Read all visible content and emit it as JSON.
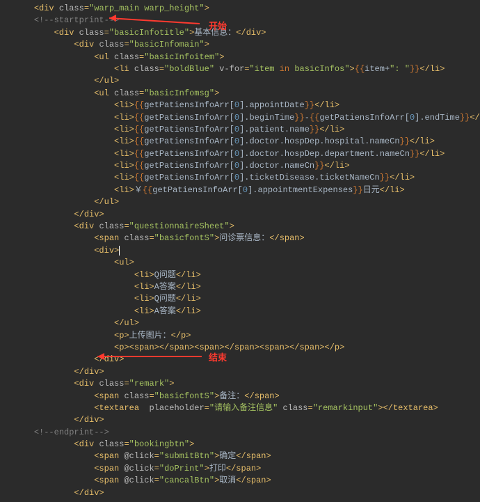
{
  "annotations": {
    "start_label": "开始",
    "end_label": "结束"
  },
  "code": {
    "l1": {
      "indent": "    ",
      "open": "<div ",
      "attr": "class",
      "val": "warp_main warp_height",
      "close": ">"
    },
    "l2": {
      "indent": "    ",
      "text": "<!--startprint-->"
    },
    "l3": {
      "indent": "        ",
      "open": "<div ",
      "attr": "class",
      "val": "basicInfotitle",
      "mid": ">",
      "content": "基本信息：",
      "close": "</div>"
    },
    "l4": {
      "indent": "            ",
      "open": "<div ",
      "attr": "class",
      "val": "basicInfomain",
      "close": ">"
    },
    "l5": {
      "indent": "                ",
      "open": "<ul ",
      "attr": "class",
      "val": "basicInfoitem",
      "close": ">"
    },
    "l6": {
      "indent": "                    ",
      "open": "<li ",
      "a1": "class",
      "v1": "boldBlue",
      "a2": "v-for",
      "v2": "item in basicInfos",
      "mid": ">",
      "must": "{{item+\": \"}}",
      "close": "</li>"
    },
    "l7": {
      "indent": "                ",
      "close": "</ul>"
    },
    "l8": {
      "indent": "                ",
      "open": "<ul ",
      "attr": "class",
      "val": "basicInfomsg",
      "close": ">"
    },
    "l9": {
      "indent": "                    ",
      "open": "<li>",
      "must": "{{getPatiensInfoArr[0].appointDate}}",
      "close": "</li>"
    },
    "l10": {
      "indent": "                    ",
      "open": "<li>",
      "m1": "{{getPatiensInfoArr[0].beginTime}}",
      "dash": "-",
      "m2": "{{getPatiensInfoArr[0].endTime}}",
      "close": "</li>"
    },
    "l11": {
      "indent": "                    ",
      "open": "<li>",
      "must": "{{getPatiensInfoArr[0].patient.name}}",
      "close": "</li>"
    },
    "l12": {
      "indent": "                    ",
      "open": "<li>",
      "must": "{{getPatiensInfoArr[0].doctor.hospDep.hospital.nameCn}}",
      "close": "</li>"
    },
    "l13": {
      "indent": "                    ",
      "open": "<li>",
      "must": "{{getPatiensInfoArr[0].doctor.hospDep.department.nameCn}}",
      "close": "</li>"
    },
    "l14": {
      "indent": "                    ",
      "open": "<li>",
      "must": "{{getPatiensInfoArr[0].doctor.nameCn}}",
      "close": "</li>"
    },
    "l15": {
      "indent": "                    ",
      "open": "<li>",
      "must": "{{getPatiensInfoArr[0].ticketDisease.ticketNameCn}}",
      "close": "</li>"
    },
    "l16": {
      "indent": "                    ",
      "open": "<li>",
      "pre": "￥",
      "must": "{{getPatiensInfoArr[0].appointmentExpenses}}",
      "post": "日元",
      "close": "</li>"
    },
    "l17": {
      "indent": "                ",
      "close": "</ul>"
    },
    "l18": {
      "indent": "            ",
      "close": "</div>"
    },
    "l19": {
      "indent": "            ",
      "open": "<div ",
      "attr": "class",
      "val": "questionnaireSheet",
      "close": ">"
    },
    "l20": {
      "indent": "                ",
      "open": "<span ",
      "attr": "class",
      "val": "basicfontS",
      "mid": ">",
      "content": "问诊票信息：",
      "close": "</span>"
    },
    "l21": {
      "indent": "                ",
      "open": "<div>"
    },
    "l22": {
      "indent": "                    ",
      "open": "<ul>"
    },
    "l23": {
      "indent": "                        ",
      "open": "<li>",
      "content": "Q问题",
      "close": "</li>"
    },
    "l24": {
      "indent": "                        ",
      "open": "<li>",
      "content": "A答案",
      "close": "</li>"
    },
    "l25": {
      "indent": "                        ",
      "open": "<li>",
      "content": "Q问题",
      "close": "</li>"
    },
    "l26": {
      "indent": "                        ",
      "open": "<li>",
      "content": "A答案",
      "close": "</li>"
    },
    "l27": {
      "indent": "                    ",
      "close": "</ul>"
    },
    "l28": {
      "indent": "                    ",
      "open": "<p>",
      "content": "上传图片：",
      "close": "</p>"
    },
    "l29": {
      "indent": "                    ",
      "open": "<p>",
      "s": "<span></span><span></span><span></span>",
      "close": "</p>"
    },
    "l30": {
      "indent": "                ",
      "close": "</div>"
    },
    "l31": {
      "indent": "            ",
      "close": "</div>"
    },
    "l32": {
      "indent": "            ",
      "open": "<div ",
      "attr": "class",
      "val": "remark",
      "close": ">"
    },
    "l33": {
      "indent": "                ",
      "open": "<span ",
      "attr": "class",
      "val": "basicfontS",
      "mid": ">",
      "content": "备注：",
      "close": "</span>"
    },
    "l34": {
      "indent": "                ",
      "open": "<textarea  ",
      "a1": "placeholder",
      "v1": "请输入备注信息",
      "a2": "class",
      "v2": "remarkinput",
      "mid": ">",
      "close": "</textarea>"
    },
    "l35": {
      "indent": "            ",
      "close": "</div>"
    },
    "l36": {
      "indent": "    ",
      "text": "<!--endprint-->"
    },
    "l37": {
      "indent": "            ",
      "open": "<div ",
      "attr": "class",
      "val": "bookingbtn",
      "close": ">"
    },
    "l38": {
      "indent": "                ",
      "open": "<span ",
      "attr": "@click",
      "val": "submitBtn",
      "mid": ">",
      "content": "确定",
      "close": "</span>"
    },
    "l39": {
      "indent": "                ",
      "open": "<span ",
      "attr": "@click",
      "val": "doPrint",
      "mid": ">",
      "content": "打印",
      "close": "</span>"
    },
    "l40": {
      "indent": "                ",
      "open": "<span ",
      "attr": "@click",
      "val": "cancalBtn",
      "mid": ">",
      "content": "取消",
      "close": "</span>"
    },
    "l41": {
      "indent": "            ",
      "close": "</div>"
    }
  }
}
